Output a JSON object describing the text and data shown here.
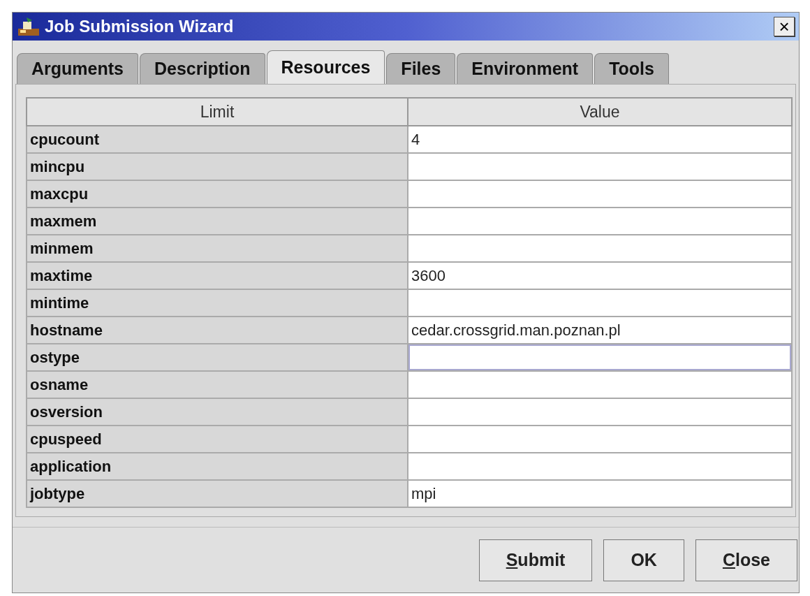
{
  "window": {
    "title": "Job Submission Wizard",
    "close_label": "×"
  },
  "tabs": [
    {
      "label": "Arguments",
      "selected": false
    },
    {
      "label": "Description",
      "selected": false
    },
    {
      "label": "Resources",
      "selected": true
    },
    {
      "label": "Files",
      "selected": false
    },
    {
      "label": "Environment",
      "selected": false
    },
    {
      "label": "Tools",
      "selected": false
    }
  ],
  "table": {
    "columns": [
      "Limit",
      "Value"
    ],
    "rows": [
      {
        "limit": "cpucount",
        "value": "4",
        "focused": false
      },
      {
        "limit": "mincpu",
        "value": "",
        "focused": false
      },
      {
        "limit": "maxcpu",
        "value": "",
        "focused": false
      },
      {
        "limit": "maxmem",
        "value": "",
        "focused": false
      },
      {
        "limit": "minmem",
        "value": "",
        "focused": false
      },
      {
        "limit": "maxtime",
        "value": "3600",
        "focused": false
      },
      {
        "limit": "mintime",
        "value": "",
        "focused": false
      },
      {
        "limit": "hostname",
        "value": "cedar.crossgrid.man.poznan.pl",
        "focused": false
      },
      {
        "limit": "ostype",
        "value": "",
        "focused": true
      },
      {
        "limit": "osname",
        "value": "",
        "focused": false
      },
      {
        "limit": "osversion",
        "value": "",
        "focused": false
      },
      {
        "limit": "cpuspeed",
        "value": "",
        "focused": false
      },
      {
        "limit": "application",
        "value": "",
        "focused": false
      },
      {
        "limit": "jobtype",
        "value": "mpi",
        "focused": false
      }
    ]
  },
  "buttons": [
    {
      "label": "Submit",
      "underline_first": true
    },
    {
      "label": "OK",
      "underline_first": false
    },
    {
      "label": "Close",
      "underline_first": true
    }
  ]
}
